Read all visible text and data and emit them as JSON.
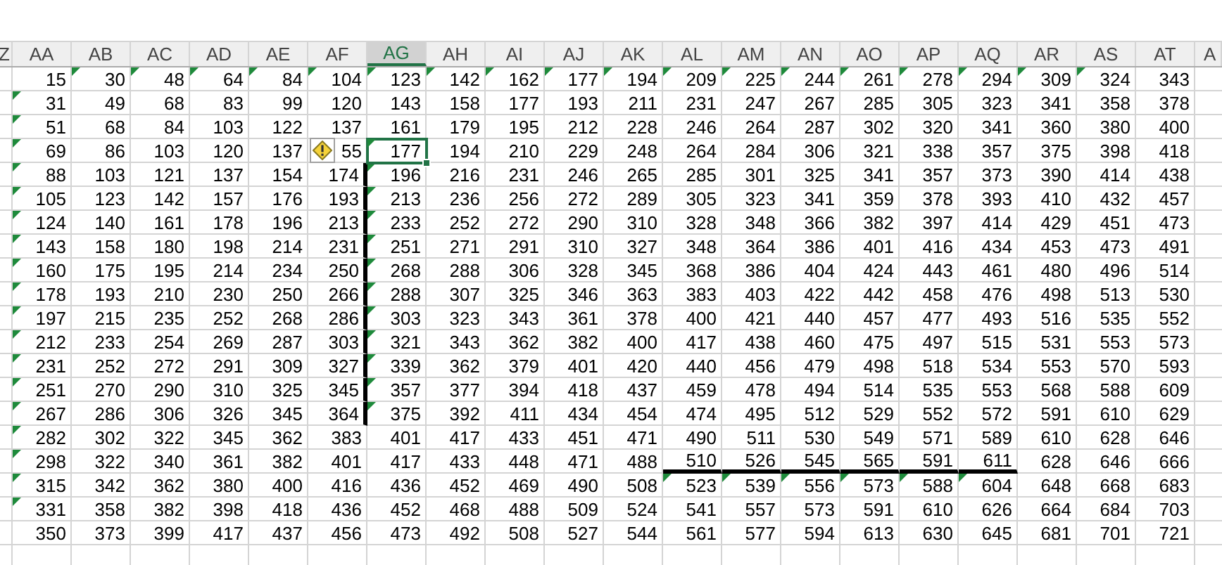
{
  "columns": [
    {
      "label": "Z",
      "selected": false
    },
    {
      "label": "AA",
      "selected": false
    },
    {
      "label": "AB",
      "selected": false
    },
    {
      "label": "AC",
      "selected": false
    },
    {
      "label": "AD",
      "selected": false
    },
    {
      "label": "AE",
      "selected": false
    },
    {
      "label": "AF",
      "selected": false
    },
    {
      "label": "AG",
      "selected": true
    },
    {
      "label": "AH",
      "selected": false
    },
    {
      "label": "AI",
      "selected": false
    },
    {
      "label": "AJ",
      "selected": false
    },
    {
      "label": "AK",
      "selected": false
    },
    {
      "label": "AL",
      "selected": false
    },
    {
      "label": "AM",
      "selected": false
    },
    {
      "label": "AN",
      "selected": false
    },
    {
      "label": "AO",
      "selected": false
    },
    {
      "label": "AP",
      "selected": false
    },
    {
      "label": "AQ",
      "selected": false
    },
    {
      "label": "AR",
      "selected": false
    },
    {
      "label": "AS",
      "selected": false
    },
    {
      "label": "AT",
      "selected": false
    },
    {
      "label": "A",
      "selected": false
    }
  ],
  "rows": [
    {
      "cells": [
        "15",
        "30",
        "48",
        "64",
        "84",
        "104",
        "123",
        "142",
        "162",
        "177",
        "194",
        "209",
        "225",
        "244",
        "261",
        "278",
        "294",
        "309",
        "324",
        "343"
      ],
      "error_marks": [
        false,
        true,
        true,
        true,
        true,
        true,
        true,
        true,
        true,
        true,
        true,
        true,
        true,
        true,
        true,
        true,
        true,
        true,
        true,
        false
      ]
    },
    {
      "cells": [
        "31",
        "49",
        "68",
        "83",
        "99",
        "120",
        "143",
        "158",
        "177",
        "193",
        "211",
        "231",
        "247",
        "267",
        "285",
        "305",
        "323",
        "341",
        "358",
        "378"
      ],
      "error_marks": [
        true,
        false,
        false,
        false,
        false,
        false,
        false,
        false,
        false,
        false,
        false,
        false,
        false,
        false,
        false,
        false,
        false,
        false,
        false,
        false
      ]
    },
    {
      "cells": [
        "51",
        "68",
        "84",
        "103",
        "122",
        "137",
        "161",
        "179",
        "195",
        "212",
        "228",
        "246",
        "264",
        "287",
        "302",
        "320",
        "341",
        "360",
        "380",
        "400"
      ],
      "error_marks": [
        true,
        false,
        false,
        false,
        false,
        false,
        false,
        false,
        false,
        false,
        false,
        false,
        false,
        false,
        false,
        false,
        false,
        false,
        false,
        false
      ]
    },
    {
      "cells": [
        "69",
        "86",
        "103",
        "120",
        "137",
        "55",
        "177",
        "194",
        "210",
        "229",
        "248",
        "264",
        "284",
        "306",
        "321",
        "338",
        "357",
        "375",
        "398",
        "418"
      ],
      "error_marks": [
        true,
        false,
        false,
        false,
        false,
        false,
        true,
        false,
        false,
        false,
        false,
        false,
        false,
        false,
        false,
        false,
        false,
        false,
        false,
        false
      ],
      "selected": [
        false,
        false,
        false,
        false,
        false,
        false,
        true,
        false,
        false,
        false,
        false,
        false,
        false,
        false,
        false,
        false,
        false,
        false,
        false,
        false
      ],
      "warning": [
        false,
        false,
        false,
        false,
        false,
        true,
        false,
        false,
        false,
        false,
        false,
        false,
        false,
        false,
        false,
        false,
        false,
        false,
        false,
        false
      ]
    },
    {
      "cells": [
        "88",
        "103",
        "121",
        "137",
        "154",
        "174",
        "196",
        "216",
        "231",
        "246",
        "265",
        "285",
        "301",
        "325",
        "341",
        "357",
        "373",
        "390",
        "414",
        "438"
      ],
      "error_marks": [
        true,
        false,
        false,
        false,
        false,
        false,
        true,
        false,
        false,
        false,
        false,
        false,
        false,
        false,
        false,
        false,
        false,
        false,
        false,
        false
      ],
      "thick_right": [
        false,
        false,
        false,
        false,
        false,
        true,
        false,
        false,
        false,
        false,
        false,
        false,
        false,
        false,
        false,
        false,
        false,
        false,
        false,
        false
      ]
    },
    {
      "cells": [
        "105",
        "123",
        "142",
        "157",
        "176",
        "193",
        "213",
        "236",
        "256",
        "272",
        "289",
        "305",
        "323",
        "341",
        "359",
        "378",
        "393",
        "410",
        "432",
        "457"
      ],
      "error_marks": [
        true,
        false,
        false,
        false,
        false,
        false,
        true,
        false,
        false,
        false,
        false,
        false,
        false,
        false,
        false,
        false,
        false,
        false,
        false,
        false
      ],
      "thick_right": [
        false,
        false,
        false,
        false,
        false,
        true,
        false,
        false,
        false,
        false,
        false,
        false,
        false,
        false,
        false,
        false,
        false,
        false,
        false,
        false
      ]
    },
    {
      "cells": [
        "124",
        "140",
        "161",
        "178",
        "196",
        "213",
        "233",
        "252",
        "272",
        "290",
        "310",
        "328",
        "348",
        "366",
        "382",
        "397",
        "414",
        "429",
        "451",
        "473"
      ],
      "error_marks": [
        true,
        false,
        false,
        false,
        false,
        false,
        true,
        false,
        false,
        false,
        false,
        false,
        false,
        false,
        false,
        false,
        false,
        false,
        false,
        false
      ],
      "thick_right": [
        false,
        false,
        false,
        false,
        false,
        true,
        false,
        false,
        false,
        false,
        false,
        false,
        false,
        false,
        false,
        false,
        false,
        false,
        false,
        false
      ]
    },
    {
      "cells": [
        "143",
        "158",
        "180",
        "198",
        "214",
        "231",
        "251",
        "271",
        "291",
        "310",
        "327",
        "348",
        "364",
        "386",
        "401",
        "416",
        "434",
        "453",
        "473",
        "491"
      ],
      "error_marks": [
        true,
        false,
        false,
        false,
        false,
        false,
        true,
        false,
        false,
        false,
        false,
        false,
        false,
        false,
        false,
        false,
        false,
        false,
        false,
        false
      ],
      "thick_right": [
        false,
        false,
        false,
        false,
        false,
        true,
        false,
        false,
        false,
        false,
        false,
        false,
        false,
        false,
        false,
        false,
        false,
        false,
        false,
        false
      ]
    },
    {
      "cells": [
        "160",
        "175",
        "195",
        "214",
        "234",
        "250",
        "268",
        "288",
        "306",
        "328",
        "345",
        "368",
        "386",
        "404",
        "424",
        "443",
        "461",
        "480",
        "496",
        "514"
      ],
      "error_marks": [
        true,
        false,
        false,
        false,
        false,
        false,
        true,
        false,
        false,
        false,
        false,
        false,
        false,
        false,
        false,
        false,
        false,
        false,
        false,
        false
      ],
      "thick_right": [
        false,
        false,
        false,
        false,
        false,
        true,
        false,
        false,
        false,
        false,
        false,
        false,
        false,
        false,
        false,
        false,
        false,
        false,
        false,
        false
      ]
    },
    {
      "cells": [
        "178",
        "193",
        "210",
        "230",
        "250",
        "266",
        "288",
        "307",
        "325",
        "346",
        "363",
        "383",
        "403",
        "422",
        "442",
        "458",
        "476",
        "498",
        "513",
        "530"
      ],
      "error_marks": [
        true,
        false,
        false,
        false,
        false,
        false,
        true,
        false,
        false,
        false,
        false,
        false,
        false,
        false,
        false,
        false,
        false,
        false,
        false,
        false
      ],
      "thick_right": [
        false,
        false,
        false,
        false,
        false,
        true,
        false,
        false,
        false,
        false,
        false,
        false,
        false,
        false,
        false,
        false,
        false,
        false,
        false,
        false
      ]
    },
    {
      "cells": [
        "197",
        "215",
        "235",
        "252",
        "268",
        "286",
        "303",
        "323",
        "343",
        "361",
        "378",
        "400",
        "421",
        "440",
        "457",
        "477",
        "493",
        "516",
        "535",
        "552"
      ],
      "error_marks": [
        true,
        false,
        false,
        false,
        false,
        false,
        true,
        false,
        false,
        false,
        false,
        false,
        false,
        false,
        false,
        false,
        false,
        false,
        false,
        false
      ],
      "thick_right": [
        false,
        false,
        false,
        false,
        false,
        true,
        false,
        false,
        false,
        false,
        false,
        false,
        false,
        false,
        false,
        false,
        false,
        false,
        false,
        false
      ]
    },
    {
      "cells": [
        "212",
        "233",
        "254",
        "269",
        "287",
        "303",
        "321",
        "343",
        "362",
        "382",
        "400",
        "417",
        "438",
        "460",
        "475",
        "497",
        "515",
        "531",
        "553",
        "573"
      ],
      "error_marks": [
        true,
        false,
        false,
        false,
        false,
        false,
        true,
        false,
        false,
        false,
        false,
        false,
        false,
        false,
        false,
        false,
        false,
        false,
        false,
        false
      ],
      "thick_right": [
        false,
        false,
        false,
        false,
        false,
        true,
        false,
        false,
        false,
        false,
        false,
        false,
        false,
        false,
        false,
        false,
        false,
        false,
        false,
        false
      ]
    },
    {
      "cells": [
        "231",
        "252",
        "272",
        "291",
        "309",
        "327",
        "339",
        "362",
        "379",
        "401",
        "420",
        "440",
        "456",
        "479",
        "498",
        "518",
        "534",
        "553",
        "570",
        "593"
      ],
      "error_marks": [
        true,
        false,
        false,
        false,
        false,
        false,
        true,
        false,
        false,
        false,
        false,
        false,
        false,
        false,
        false,
        false,
        false,
        false,
        false,
        false
      ],
      "thick_right": [
        false,
        false,
        false,
        false,
        false,
        true,
        false,
        false,
        false,
        false,
        false,
        false,
        false,
        false,
        false,
        false,
        false,
        false,
        false,
        false
      ]
    },
    {
      "cells": [
        "251",
        "270",
        "290",
        "310",
        "325",
        "345",
        "357",
        "377",
        "394",
        "418",
        "437",
        "459",
        "478",
        "494",
        "514",
        "535",
        "553",
        "568",
        "588",
        "609"
      ],
      "error_marks": [
        true,
        false,
        false,
        false,
        false,
        false,
        true,
        false,
        false,
        false,
        false,
        false,
        false,
        false,
        false,
        false,
        false,
        false,
        false,
        false
      ],
      "thick_right": [
        false,
        false,
        false,
        false,
        false,
        true,
        false,
        false,
        false,
        false,
        false,
        false,
        false,
        false,
        false,
        false,
        false,
        false,
        false,
        false
      ]
    },
    {
      "cells": [
        "267",
        "286",
        "306",
        "326",
        "345",
        "364",
        "375",
        "392",
        "411",
        "434",
        "454",
        "474",
        "495",
        "512",
        "529",
        "552",
        "572",
        "591",
        "610",
        "629"
      ],
      "error_marks": [
        true,
        false,
        false,
        false,
        false,
        false,
        true,
        false,
        false,
        false,
        false,
        false,
        false,
        false,
        false,
        false,
        false,
        false,
        false,
        false
      ],
      "thick_right": [
        false,
        false,
        false,
        false,
        false,
        true,
        false,
        false,
        false,
        false,
        false,
        false,
        false,
        false,
        false,
        false,
        false,
        false,
        false,
        false
      ]
    },
    {
      "cells": [
        "282",
        "302",
        "322",
        "345",
        "362",
        "383",
        "401",
        "417",
        "433",
        "451",
        "471",
        "490",
        "511",
        "530",
        "549",
        "571",
        "589",
        "610",
        "628",
        "646"
      ],
      "error_marks": [
        true,
        false,
        false,
        false,
        false,
        false,
        false,
        false,
        false,
        false,
        false,
        false,
        false,
        false,
        false,
        false,
        false,
        false,
        false,
        false
      ]
    },
    {
      "cells": [
        "298",
        "322",
        "340",
        "361",
        "382",
        "401",
        "417",
        "433",
        "448",
        "471",
        "488",
        "510",
        "526",
        "545",
        "565",
        "591",
        "611",
        "628",
        "646",
        "666"
      ],
      "error_marks": [
        true,
        false,
        false,
        false,
        false,
        false,
        false,
        false,
        false,
        false,
        false,
        false,
        false,
        false,
        false,
        false,
        false,
        false,
        false,
        false
      ],
      "thick_bottom": [
        false,
        false,
        false,
        false,
        false,
        false,
        false,
        false,
        false,
        false,
        false,
        true,
        true,
        true,
        true,
        true,
        true,
        false,
        false,
        false
      ]
    },
    {
      "cells": [
        "315",
        "342",
        "362",
        "380",
        "400",
        "416",
        "436",
        "452",
        "469",
        "490",
        "508",
        "523",
        "539",
        "556",
        "573",
        "588",
        "604",
        "648",
        "668",
        "683"
      ],
      "error_marks": [
        true,
        false,
        false,
        false,
        false,
        false,
        false,
        false,
        false,
        false,
        false,
        true,
        true,
        true,
        true,
        true,
        true,
        false,
        false,
        false
      ]
    },
    {
      "cells": [
        "331",
        "358",
        "382",
        "398",
        "418",
        "436",
        "452",
        "468",
        "488",
        "509",
        "524",
        "541",
        "557",
        "573",
        "591",
        "610",
        "626",
        "664",
        "684",
        "703"
      ],
      "error_marks": [
        true,
        false,
        false,
        false,
        false,
        false,
        false,
        false,
        false,
        false,
        false,
        false,
        false,
        false,
        false,
        false,
        false,
        false,
        false,
        false
      ]
    },
    {
      "cells": [
        "350",
        "373",
        "399",
        "417",
        "437",
        "456",
        "473",
        "492",
        "508",
        "527",
        "544",
        "561",
        "577",
        "594",
        "613",
        "630",
        "645",
        "681",
        "701",
        "721"
      ],
      "error_marks": [
        false,
        false,
        false,
        false,
        false,
        false,
        false,
        false,
        false,
        false,
        false,
        false,
        false,
        false,
        false,
        false,
        false,
        false,
        false,
        false
      ]
    }
  ]
}
